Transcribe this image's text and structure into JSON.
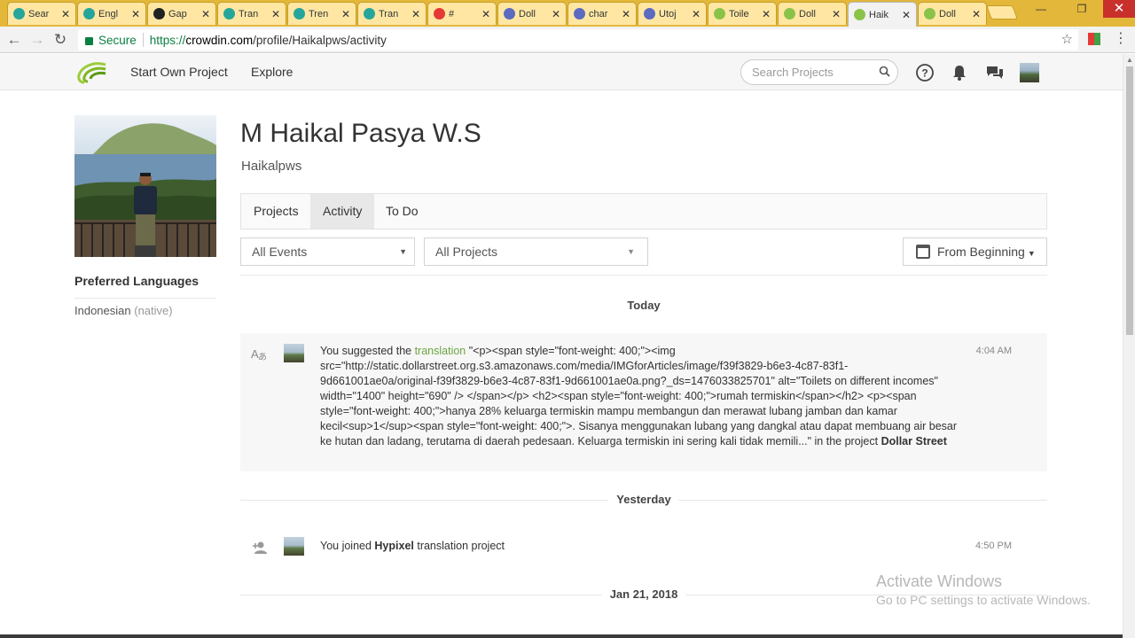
{
  "browser": {
    "tabs": [
      {
        "title": "Sear",
        "color": "#26a69a"
      },
      {
        "title": "Engl",
        "color": "#26a69a"
      },
      {
        "title": "Gap",
        "color": "#222222"
      },
      {
        "title": "Tran",
        "color": "#26a69a"
      },
      {
        "title": "Tren",
        "color": "#26a69a"
      },
      {
        "title": "Tran",
        "color": "#26a69a"
      },
      {
        "title": "#",
        "color": "#e53935"
      },
      {
        "title": "Doll",
        "color": "#5c6bc0"
      },
      {
        "title": "char",
        "color": "#5c6bc0"
      },
      {
        "title": "Utoj",
        "color": "#5c6bc0"
      },
      {
        "title": "Toile",
        "color": "#8bc34a"
      },
      {
        "title": "Doll",
        "color": "#8bc34a"
      },
      {
        "title": "Haik",
        "color": "#8bc34a",
        "active": true
      },
      {
        "title": "Doll",
        "color": "#8bc34a"
      }
    ],
    "secure_label": "Secure",
    "url_scheme": "https://",
    "url_host": "crowdin.com",
    "url_path": "/profile/Haikalpws/activity"
  },
  "header": {
    "start_project": "Start Own Project",
    "explore": "Explore",
    "search_placeholder": "Search Projects"
  },
  "profile": {
    "full_name": "M Haikal Pasya W.S",
    "username": "Haikalpws",
    "pref_title": "Preferred Languages",
    "language": "Indonesian",
    "language_note": "(native)"
  },
  "tabs": {
    "projects": "Projects",
    "activity": "Activity",
    "todo": "To Do"
  },
  "filters": {
    "events": "All Events",
    "projects": "All Projects",
    "date": "From Beginning"
  },
  "feed": {
    "day1": "Today",
    "day2": "Yesterday",
    "day3": "Jan 21, 2018",
    "item1": {
      "prefix": "You suggested the ",
      "link": "translation",
      "body": " \"<p><span style=\"font-weight: 400;\"><img src=\"http://static.dollarstreet.org.s3.amazonaws.com/media/IMGforArticles/image/f39f3829-b6e3-4c87-83f1-9d661001ae0a/original-f39f3829-b6e3-4c87-83f1-9d661001ae0a.png?_ds=1476033825701\" alt=\"Toilets on different incomes\" width=\"1400\" height=\"690\" /> </span></p> <h2><span style=\"font-weight: 400;\">rumah termiskin</span></h2> <p><span style=\"font-weight: 400;\">hanya 28% keluarga termiskin mampu membangun dan merawat lubang jamban dan kamar kecil<sup>1</sup><span style=\"font-weight: 400;\">. Sisanya menggunakan lubang yang dangkal atau dapat membuang air besar ke hutan dan ladang, terutama di daerah pedesaan. Keluarga termiskin ini sering kali tidak memili...\" in the project ",
      "project": "Dollar Street",
      "time": "4:04 AM"
    },
    "item2": {
      "prefix": "You joined ",
      "project": "Hypixel",
      "suffix": " translation project",
      "time": "4:50 PM"
    }
  },
  "watermark": {
    "title": "Activate Windows",
    "subtitle": "Go to PC settings to activate Windows."
  }
}
